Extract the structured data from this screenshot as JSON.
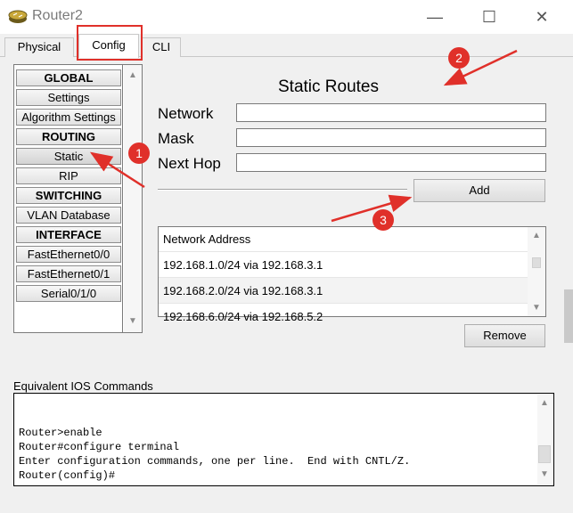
{
  "window": {
    "title": "Router2",
    "controls": {
      "minimize": "—",
      "maximize": "☐",
      "close": "✕"
    }
  },
  "tabs": [
    {
      "label": "Physical"
    },
    {
      "label": "Config",
      "active": true
    },
    {
      "label": "CLI"
    }
  ],
  "sidebar": {
    "items": [
      {
        "label": "GLOBAL",
        "header": true
      },
      {
        "label": "Settings"
      },
      {
        "label": "Algorithm Settings"
      },
      {
        "label": "ROUTING",
        "header": true
      },
      {
        "label": "Static",
        "selected": true
      },
      {
        "label": "RIP"
      },
      {
        "label": "SWITCHING",
        "header": true
      },
      {
        "label": "VLAN Database"
      },
      {
        "label": "INTERFACE",
        "header": true
      },
      {
        "label": "FastEthernet0/0"
      },
      {
        "label": "FastEthernet0/1"
      },
      {
        "label": "Serial0/1/0"
      }
    ]
  },
  "static_routes": {
    "title": "Static Routes",
    "network_label": "Network",
    "mask_label": "Mask",
    "next_hop_label": "Next Hop",
    "network_value": "",
    "mask_value": "",
    "next_hop_value": "",
    "add_button": "Add",
    "list_header": "Network Address",
    "routes": [
      "192.168.1.0/24 via 192.168.3.1",
      "192.168.2.0/24 via 192.168.3.1",
      "192.168.6.0/24 via 192.168.5.2"
    ],
    "remove_button": "Remove"
  },
  "ios": {
    "label": "Equivalent IOS Commands",
    "lines": [
      "Router>enable",
      "Router#configure terminal",
      "Enter configuration commands, one per line.  End with CNTL/Z.",
      "Router(config)#"
    ]
  },
  "annotations": [
    "1",
    "2",
    "3"
  ],
  "colors": {
    "annotation_red": "#e0302a",
    "window_bg": "#f0f0f0"
  }
}
